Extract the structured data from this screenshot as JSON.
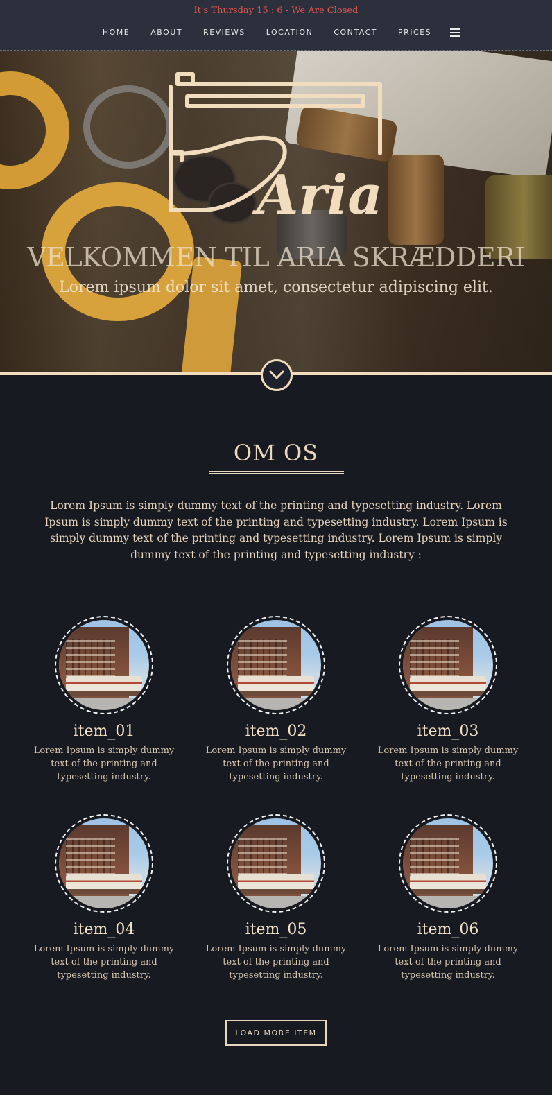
{
  "header": {
    "status": "It's Thursday 15 : 6 - We Are Closed",
    "nav": [
      "HOME",
      "ABOUT",
      "REVIEWS",
      "LOCATION",
      "CONTACT",
      "PRICES"
    ],
    "menu_icon": "hamburger-icon"
  },
  "hero": {
    "logo_text": "Aria",
    "title": "VELKOMMEN TIL ARIA SKRÆDDERI",
    "subtitle": "Lorem ipsum dolor sit amet, consectetur adipiscing elit.",
    "scroll_icon": "chevron-down-icon"
  },
  "about": {
    "title": "OM OS",
    "text": "Lorem Ipsum is simply dummy text of the printing and typesetting industry. Lorem Ipsum is simply dummy text of the printing and typesetting industry. Lorem Ipsum is simply dummy text of the printing and typesetting industry. Lorem Ipsum is simply dummy text of the printing and typesetting industry :"
  },
  "items": [
    {
      "title": "item_01",
      "text": "Lorem Ipsum is simply dummy text of the printing and typesetting industry."
    },
    {
      "title": "item_02",
      "text": "Lorem Ipsum is simply dummy text of the printing and typesetting industry."
    },
    {
      "title": "item_03",
      "text": "Lorem Ipsum is simply dummy text of the printing and typesetting industry."
    },
    {
      "title": "item_04",
      "text": "Lorem Ipsum is simply dummy text of the printing and typesetting industry."
    },
    {
      "title": "item_05",
      "text": "Lorem Ipsum is simply dummy text of the printing and typesetting industry."
    },
    {
      "title": "item_06",
      "text": "Lorem Ipsum is simply dummy text of the printing and typesetting industry."
    }
  ],
  "load_more_label": "LOAD MORE ITEM",
  "colors": {
    "accent": "#f2dcbe",
    "status": "#e2574c",
    "background": "#171a21",
    "header": "#2b303c"
  }
}
